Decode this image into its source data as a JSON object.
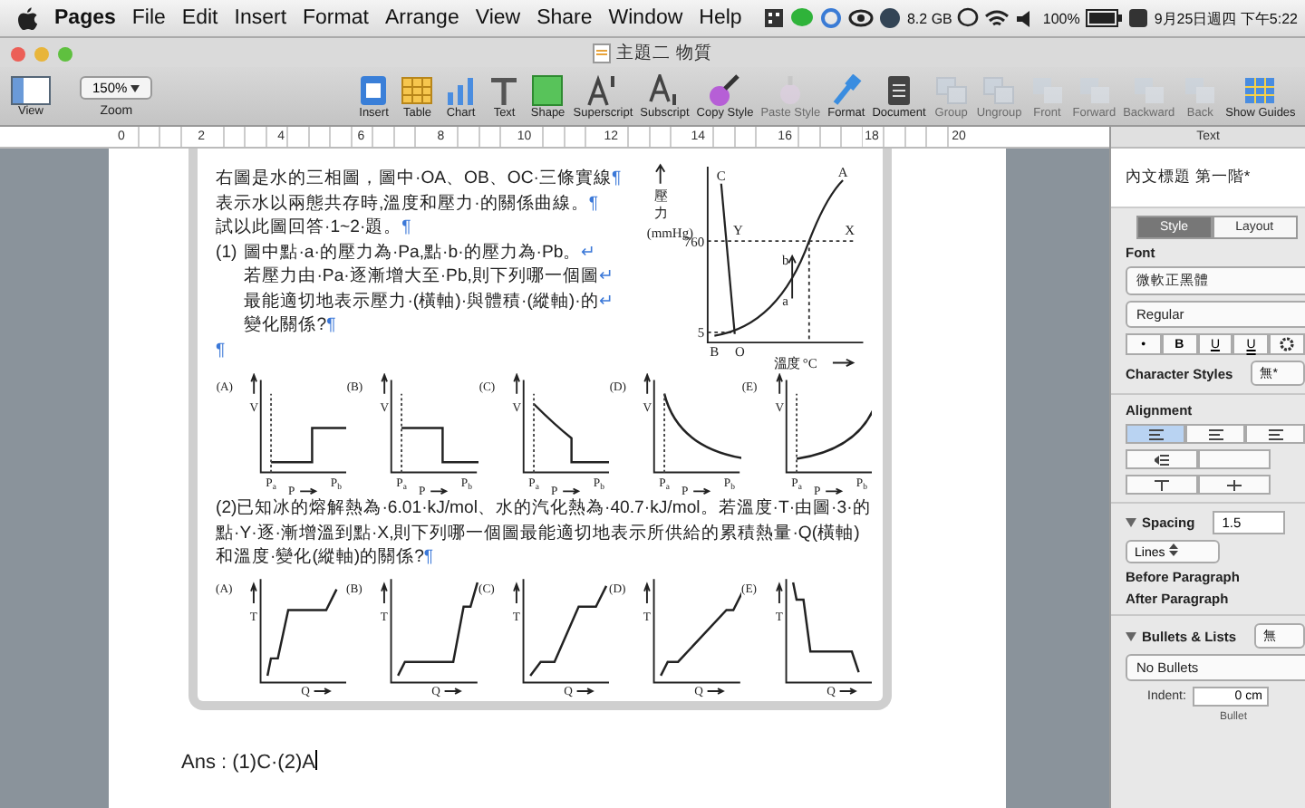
{
  "menubar": {
    "app": "Pages",
    "items": [
      "File",
      "Edit",
      "Insert",
      "Format",
      "Arrange",
      "View",
      "Share",
      "Window",
      "Help"
    ],
    "memory": "8.2 GB",
    "battery": "100%",
    "clock": "9月25日週四 下午5:22"
  },
  "window": {
    "title": "主題二 物質"
  },
  "toolbar": {
    "view": "View",
    "zoom": {
      "label": "Zoom",
      "value": "150%"
    },
    "items": [
      {
        "label": "Insert",
        "kind": "insert",
        "disabled": false
      },
      {
        "label": "Table",
        "kind": "table",
        "disabled": false
      },
      {
        "label": "Chart",
        "kind": "chart",
        "disabled": false
      },
      {
        "label": "Text",
        "kind": "text",
        "disabled": false
      },
      {
        "label": "Shape",
        "kind": "shape",
        "disabled": false
      },
      {
        "label": "Superscript",
        "kind": "sup",
        "disabled": false
      },
      {
        "label": "Subscript",
        "kind": "sub",
        "disabled": false
      },
      {
        "label": "Copy Style",
        "kind": "copy",
        "disabled": false
      },
      {
        "label": "Paste Style",
        "kind": "paste",
        "disabled": true
      },
      {
        "label": "Format",
        "kind": "format",
        "disabled": false
      },
      {
        "label": "Document",
        "kind": "document",
        "disabled": false
      },
      {
        "label": "Group",
        "kind": "group",
        "disabled": true
      },
      {
        "label": "Ungroup",
        "kind": "group",
        "disabled": true
      },
      {
        "label": "Front",
        "kind": "arrange",
        "disabled": true
      },
      {
        "label": "Forward",
        "kind": "arrange",
        "disabled": true
      },
      {
        "label": "Backward",
        "kind": "arrange",
        "disabled": true
      },
      {
        "label": "Back",
        "kind": "arrange",
        "disabled": true
      },
      {
        "label": "Show Guides",
        "kind": "guides",
        "disabled": false
      }
    ]
  },
  "ruler": [
    "0",
    "2",
    "4",
    "6",
    "8",
    "10",
    "12",
    "14",
    "16",
    "18",
    "20"
  ],
  "document": {
    "intro": [
      {
        "text": "右圖是水的三相圖，圖中·OA、OB、OC·三條實線",
        "end": "¶"
      },
      {
        "text": "表示水以兩態共存時,溫度和壓力·的關係曲線。",
        "end": "¶"
      },
      {
        "text": "試以此圖回答·1~2·題。",
        "end": "¶"
      }
    ],
    "q1": {
      "number": "(1)",
      "lines": [
        {
          "text": "圖中點·a·的壓力為·Pa,點·b·的壓力為·Pb。",
          "end": "↵"
        },
        {
          "text": "若壓力由·Pa·逐漸增大至·Pb,則下列哪一個圖",
          "end": "↵"
        },
        {
          "text": "最能適切地表示壓力·(橫軸)·與體積·(縱軸)·的",
          "end": "↵"
        },
        {
          "text": "變化關係?",
          "end": "¶"
        }
      ]
    },
    "blank_mark": "¶",
    "diagram": {
      "y_label": [
        "壓",
        "力"
      ],
      "y_unit": "(mmHg)",
      "x_label": "溫度 °C",
      "ticks": [
        {
          "kind": "high",
          "text": "760"
        },
        {
          "kind": "low",
          "text": "5"
        }
      ],
      "points": [
        {
          "kind": "c",
          "text": "C"
        },
        {
          "kind": "a",
          "text": "A"
        },
        {
          "kind": "y",
          "text": "Y"
        },
        {
          "kind": "x",
          "text": "X"
        },
        {
          "kind": "pb",
          "text": "b"
        },
        {
          "kind": "pa",
          "text": "a"
        },
        {
          "kind": "b",
          "text": "B"
        },
        {
          "kind": "o",
          "text": "O"
        }
      ]
    },
    "graphs_1": [
      {
        "letter": "(A)",
        "y": "V",
        "x": "P",
        "kind": "step-up",
        "ticks": [
          {
            "base": "P",
            "sub": "a"
          },
          {
            "base": "P",
            "sub": "b"
          }
        ]
      },
      {
        "letter": "(B)",
        "y": "V",
        "x": "P",
        "kind": "step-down",
        "ticks": [
          {
            "base": "P",
            "sub": "a"
          },
          {
            "base": "P",
            "sub": "b"
          }
        ]
      },
      {
        "letter": "(C)",
        "y": "V",
        "x": "P",
        "kind": "curve-step",
        "ticks": [
          {
            "base": "P",
            "sub": "a"
          },
          {
            "base": "P",
            "sub": "b"
          }
        ]
      },
      {
        "letter": "(D)",
        "y": "V",
        "x": "P",
        "kind": "decay",
        "ticks": [
          {
            "base": "P",
            "sub": "a"
          },
          {
            "base": "P",
            "sub": "b"
          }
        ]
      },
      {
        "letter": "(E)",
        "y": "V",
        "x": "P",
        "kind": "growth",
        "ticks": [
          {
            "base": "P",
            "sub": "a"
          },
          {
            "base": "P",
            "sub": "b"
          }
        ]
      }
    ],
    "q2": {
      "text": "(2)已知冰的熔解熱為·6.01·kJ/mol、水的汽化熱為·40.7·kJ/mol。若溫度·T·由圖·3·的點·Y·逐·漸增溫到點·X,則下列哪一個圖最能適切地表示所供給的累積熱量·Q(橫軸)和溫度·變化(縱軸)的關係?",
      "end": "¶"
    },
    "graphs_2": [
      {
        "letter": "(A)",
        "y": "T",
        "x": "Q",
        "kind": "heat-a"
      },
      {
        "letter": "(B)",
        "y": "T",
        "x": "Q",
        "kind": "heat-b"
      },
      {
        "letter": "(C)",
        "y": "T",
        "x": "Q",
        "kind": "heat-c"
      },
      {
        "letter": "(D)",
        "y": "T",
        "x": "Q",
        "kind": "heat-d"
      },
      {
        "letter": "(E)",
        "y": "T",
        "x": "Q",
        "kind": "heat-e"
      }
    ],
    "answer": "Ans : (1)C·(2)A"
  },
  "inspector": {
    "header": "Text",
    "style_name": "內文標題 第一階*",
    "tabs": [
      {
        "label": "Style",
        "selected": true
      },
      {
        "label": "Layout",
        "selected": false
      }
    ],
    "font_heading": "Font",
    "font": "微軟正黑體",
    "typeface": "Regular",
    "font_buttons": [
      {
        "kind": "dot",
        "text": "•"
      },
      {
        "kind": "bold",
        "text": "B"
      },
      {
        "kind": "underline",
        "text": "U"
      },
      {
        "kind": "double",
        "text": "U"
      },
      {
        "kind": "gear"
      }
    ],
    "char_styles": {
      "label": "Character Styles",
      "value": "無*"
    },
    "alignment": {
      "label": "Alignment",
      "buttons": [
        {
          "selected": true
        },
        {
          "selected": false
        },
        {
          "selected": false
        }
      ]
    },
    "spacing": {
      "label": "Spacing",
      "value": "1.5",
      "unit": "Lines",
      "before": "Before Paragraph",
      "after": "After Paragraph"
    },
    "bullets": {
      "label": "Bullets & Lists",
      "value": "無",
      "type": "No Bullets",
      "indent_label": "Indent:",
      "indent": "0 cm",
      "bullet_label": "Bullet"
    }
  }
}
